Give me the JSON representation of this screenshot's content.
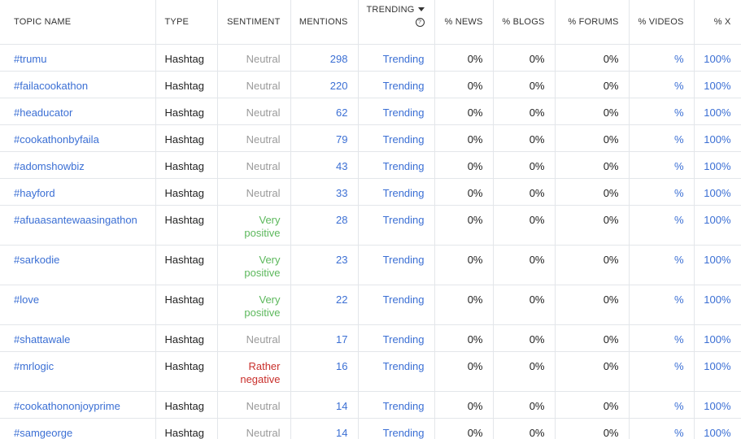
{
  "columns": {
    "topic": "TOPIC NAME",
    "type": "TYPE",
    "sentiment": "SENTIMENT",
    "mentions": "MENTIONS",
    "trending": "TRENDING",
    "news": "% NEWS",
    "blogs": "% BLOGS",
    "forums": "% FORUMS",
    "videos": "% VIDEOS",
    "x": "% X"
  },
  "help_glyph": "?",
  "rows": [
    {
      "topic": "#trumu",
      "type": "Hashtag",
      "sentiment": "Neutral",
      "sentiment_class": "neutral",
      "mentions": "298",
      "trending": "Trending",
      "news": "0%",
      "blogs": "0%",
      "forums": "0%",
      "videos": "%",
      "x": "100%"
    },
    {
      "topic": "#failacookathon",
      "type": "Hashtag",
      "sentiment": "Neutral",
      "sentiment_class": "neutral",
      "mentions": "220",
      "trending": "Trending",
      "news": "0%",
      "blogs": "0%",
      "forums": "0%",
      "videos": "%",
      "x": "100%"
    },
    {
      "topic": "#headucator",
      "type": "Hashtag",
      "sentiment": "Neutral",
      "sentiment_class": "neutral",
      "mentions": "62",
      "trending": "Trending",
      "news": "0%",
      "blogs": "0%",
      "forums": "0%",
      "videos": "%",
      "x": "100%"
    },
    {
      "topic": "#cookathonbyfaila",
      "type": "Hashtag",
      "sentiment": "Neutral",
      "sentiment_class": "neutral",
      "mentions": "79",
      "trending": "Trending",
      "news": "0%",
      "blogs": "0%",
      "forums": "0%",
      "videos": "%",
      "x": "100%"
    },
    {
      "topic": "#adomshowbiz",
      "type": "Hashtag",
      "sentiment": "Neutral",
      "sentiment_class": "neutral",
      "mentions": "43",
      "trending": "Trending",
      "news": "0%",
      "blogs": "0%",
      "forums": "0%",
      "videos": "%",
      "x": "100%"
    },
    {
      "topic": "#hayford",
      "type": "Hashtag",
      "sentiment": "Neutral",
      "sentiment_class": "neutral",
      "mentions": "33",
      "trending": "Trending",
      "news": "0%",
      "blogs": "0%",
      "forums": "0%",
      "videos": "%",
      "x": "100%"
    },
    {
      "topic": "#afuaasantewaasingathon",
      "type": "Hashtag",
      "sentiment": "Very positive",
      "sentiment_class": "very-positive",
      "sentiment_line1": "Very",
      "sentiment_line2": "positive",
      "mentions": "28",
      "trending": "Trending",
      "news": "0%",
      "blogs": "0%",
      "forums": "0%",
      "videos": "%",
      "x": "100%"
    },
    {
      "topic": "#sarkodie",
      "type": "Hashtag",
      "sentiment": "Very positive",
      "sentiment_class": "very-positive",
      "sentiment_line1": "Very",
      "sentiment_line2": "positive",
      "mentions": "23",
      "trending": "Trending",
      "news": "0%",
      "blogs": "0%",
      "forums": "0%",
      "videos": "%",
      "x": "100%"
    },
    {
      "topic": "#love",
      "type": "Hashtag",
      "sentiment": "Very positive",
      "sentiment_class": "very-positive",
      "sentiment_line1": "Very",
      "sentiment_line2": "positive",
      "mentions": "22",
      "trending": "Trending",
      "news": "0%",
      "blogs": "0%",
      "forums": "0%",
      "videos": "%",
      "x": "100%"
    },
    {
      "topic": "#shattawale",
      "type": "Hashtag",
      "sentiment": "Neutral",
      "sentiment_class": "neutral",
      "mentions": "17",
      "trending": "Trending",
      "news": "0%",
      "blogs": "0%",
      "forums": "0%",
      "videos": "%",
      "x": "100%"
    },
    {
      "topic": "#mrlogic",
      "type": "Hashtag",
      "sentiment": "Rather negative",
      "sentiment_class": "rather-negative",
      "sentiment_line1": "Rather",
      "sentiment_line2": "negative",
      "mentions": "16",
      "trending": "Trending",
      "news": "0%",
      "blogs": "0%",
      "forums": "0%",
      "videos": "%",
      "x": "100%"
    },
    {
      "topic": "#cookathononjoyprime",
      "type": "Hashtag",
      "sentiment": "Neutral",
      "sentiment_class": "neutral",
      "mentions": "14",
      "trending": "Trending",
      "news": "0%",
      "blogs": "0%",
      "forums": "0%",
      "videos": "%",
      "x": "100%"
    },
    {
      "topic": "#samgeorge",
      "type": "Hashtag",
      "sentiment": "Neutral",
      "sentiment_class": "neutral",
      "mentions": "14",
      "trending": "Trending",
      "news": "0%",
      "blogs": "0%",
      "forums": "0%",
      "videos": "%",
      "x": "100%"
    }
  ],
  "icons": {
    "sort": "caret-down-icon",
    "help": "help-circle-icon"
  },
  "colors": {
    "link": "#3b6fd4",
    "neutral": "#9a9a9a",
    "very_positive": "#5cb85c",
    "rather_negative": "#c9302c",
    "border": "#e3e6ea"
  }
}
